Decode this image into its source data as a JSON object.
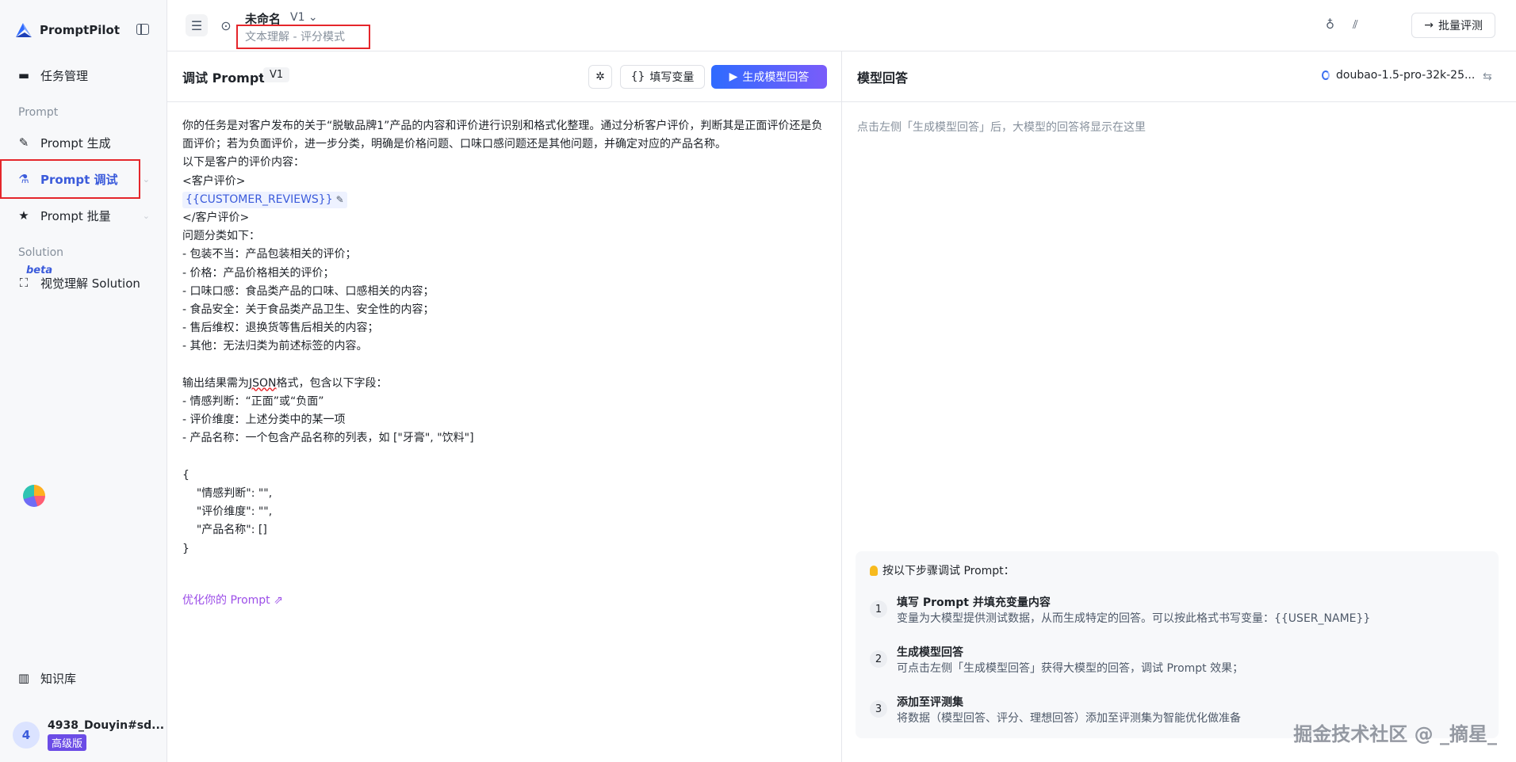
{
  "sidebar": {
    "brand": "PromptPilot",
    "items": {
      "tasks": "任务管理",
      "prompt_section": "Prompt",
      "generate": "Prompt 生成",
      "debug": "Prompt 调试",
      "batch": "Prompt 批量",
      "solution_section": "Solution",
      "beta": "beta",
      "vision": "视觉理解 Solution",
      "knowledge": "知识库"
    },
    "user": {
      "avatar": "4",
      "name": "4938_Douyin#sd...",
      "plan": "高级版"
    }
  },
  "header": {
    "title": "未命名",
    "version": "V1",
    "subtitle": "文本理解 - 评分模式",
    "batch_eval": "批量评测"
  },
  "editor": {
    "title": "调试 Prompt",
    "version_tag": "V1",
    "fill_variables": "填写变量",
    "generate": "生成模型回答",
    "text_before": "你的任务是对客户发布的关于“脱敏品牌1”产品的内容和评价进行识别和格式化整理。通过分析客户评价，判断其是正面评价还是负面评价；若为负面评价，进一步分类，明确是价格问题、口味口感问题还是其他问题，并确定对应的产品名称。\n以下是客户的评价内容：\n<客户评价>\n",
    "variable": "{{CUSTOMER_REVIEWS}}",
    "text_after_var": "\n</客户评价>\n问题分类如下：\n- 包装不当：产品包装相关的评价；\n- 价格：产品价格相关的评价；\n- 口味口感：食品类产品的口味、口感相关的内容；\n- 食品安全：关于食品类产品卫生、安全性的内容；\n- 售后维权：退换货等售后相关的内容；\n- 其他：无法归类为前述标签的内容。\n\n输出结果需为",
    "json_word": "JSON",
    "text_end": "格式，包含以下字段：\n- 情感判断：“正面”或“负面”\n- 评价维度：上述分类中的某一项\n- 产品名称：一个包含产品名称的列表，如 [\"牙膏\", \"饮料\"]\n\n{\n    \"情感判断\": \"\",\n    \"评价维度\": \"\",\n    \"产品名称\": []\n}",
    "optimize": "优化你的 Prompt"
  },
  "response": {
    "title": "模型回答",
    "model": "doubao-1.5-pro-32k-25...",
    "hint": "点击左侧「生成模型回答」后，大模型的回答将显示在这里",
    "guide_title": "按以下步骤调试 Prompt：",
    "steps": [
      {
        "num": "1",
        "title": "填写 Prompt 并填充变量内容",
        "desc": "变量为大模型提供测试数据，从而生成特定的回答。可以按此格式书写变量：{{USER_NAME}}"
      },
      {
        "num": "2",
        "title": "生成模型回答",
        "desc": "可点击左侧「生成模型回答」获得大模型的回答，调试 Prompt 效果；"
      },
      {
        "num": "3",
        "title": "添加至评测集",
        "desc": "将数据（模型回答、评分、理想回答）添加至评测集为智能优化做准备"
      }
    ]
  },
  "watermark": "掘金技术社区 @ _摘星_",
  "colors": {
    "accent": "#3b5bdb",
    "highlight_box": "#e5262b",
    "optimize_link": "#9c4ee8"
  }
}
